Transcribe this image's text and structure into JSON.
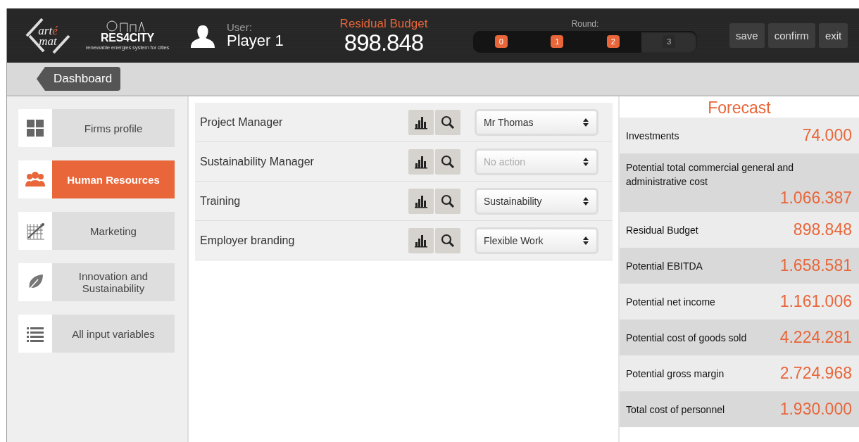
{
  "header": {
    "logos": [
      {
        "kind": "artemat",
        "parts": [
          "art",
          "é",
          "mat"
        ]
      },
      {
        "kind": "res4city",
        "name": "RES4CITY",
        "tagline": "renewable energies system for cities"
      }
    ],
    "user": {
      "label": "User:",
      "name": "Player 1"
    },
    "budget": {
      "label": "Residual Budget",
      "value": "898.848"
    },
    "rounds": {
      "label": "Round:",
      "items": [
        {
          "label": "0",
          "done": true
        },
        {
          "label": "1",
          "done": true
        },
        {
          "label": "2",
          "done": true
        },
        {
          "label": "3",
          "done": false
        }
      ]
    },
    "buttons": [
      "save",
      "confirm",
      "exit"
    ]
  },
  "nav": {
    "back_button": "Dashboard"
  },
  "sidebar": {
    "items": [
      {
        "label": "Firms profile",
        "kind": "grid",
        "selected": false
      },
      {
        "label": "Human Resources",
        "kind": "people",
        "selected": true
      },
      {
        "label": "Marketing",
        "kind": "chart",
        "selected": false
      },
      {
        "label": "Innovation and Sustainability",
        "kind": "leaf",
        "selected": false
      },
      {
        "label": "All input variables",
        "kind": "list",
        "selected": false
      }
    ]
  },
  "decisions": {
    "rows": [
      {
        "label": "Project Manager",
        "select": {
          "value": "Mr Thomas"
        }
      },
      {
        "label": "Sustainability Manager",
        "select": {
          "placeholder": "No action"
        }
      },
      {
        "label": "Training",
        "select": {
          "value": "Sustainability"
        }
      },
      {
        "label": "Employer branding",
        "select": {
          "value": "Flexible Work"
        }
      }
    ]
  },
  "forecast": {
    "title": "Forecast",
    "rows": [
      {
        "label": "Investments",
        "value": "74.000"
      },
      {
        "label": "Potential total commercial general and administrative cost",
        "value": "1.066.387"
      },
      {
        "label": "Residual Budget",
        "value": "898.848"
      },
      {
        "label": "Potential EBITDA",
        "value": "1.658.581"
      },
      {
        "label": "Potential net income",
        "value": "1.161.006"
      },
      {
        "label": "Potential cost of goods sold",
        "value": "4.224.281"
      },
      {
        "label": "Potential gross margin",
        "value": "2.724.968"
      },
      {
        "label": "Total cost of personnel",
        "value": "1.930.000"
      }
    ]
  }
}
